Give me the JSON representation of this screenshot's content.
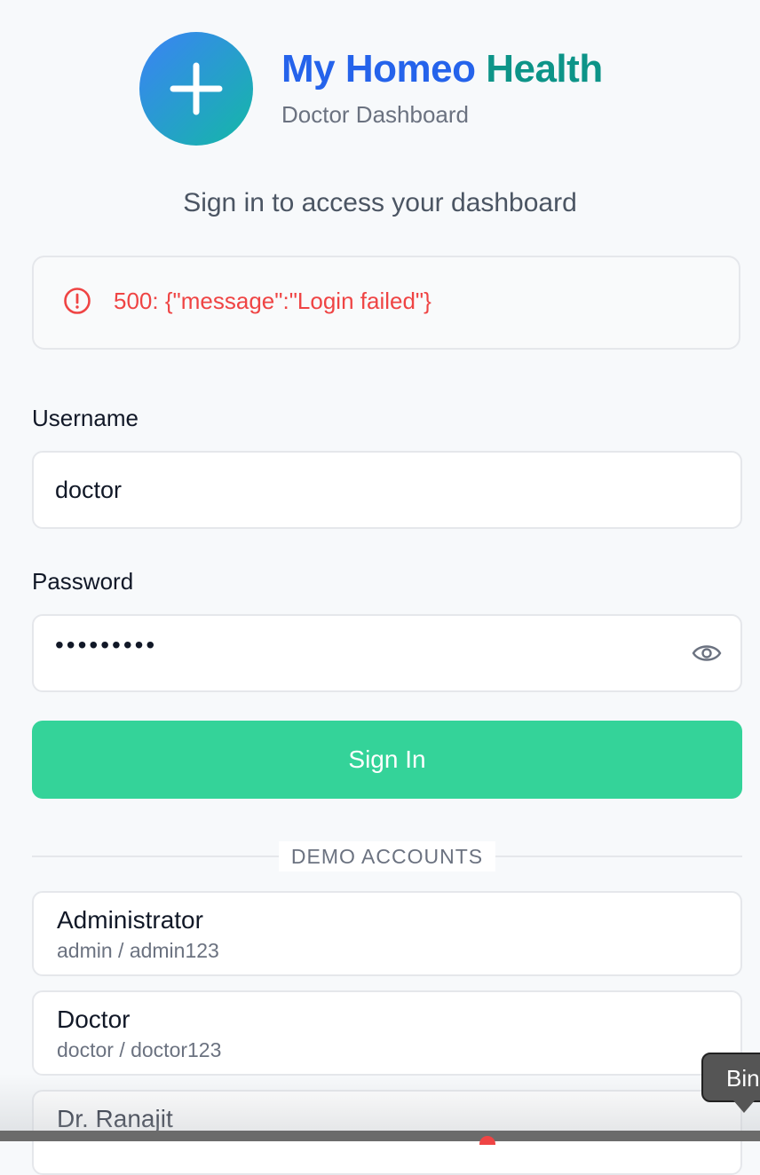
{
  "brand": {
    "title_part1": "My Homeo",
    "title_part2": "Health",
    "subtitle": "Doctor Dashboard"
  },
  "page": {
    "subtitle": "Sign in to access your dashboard"
  },
  "alert": {
    "message": "500: {\"message\":\"Login failed\"}",
    "icon": "alert-circle-icon"
  },
  "form": {
    "username_label": "Username",
    "username_value": "doctor",
    "password_label": "Password",
    "password_masked": "•••••••••",
    "show_password_icon": "eye-icon",
    "submit_label": "Sign In"
  },
  "demo": {
    "heading": "DEMO ACCOUNTS",
    "accounts": [
      {
        "name": "Administrator",
        "credentials": "admin / admin123"
      },
      {
        "name": "Doctor",
        "credentials": "doctor / doctor123"
      },
      {
        "name": "Dr. Ranajit",
        "credentials": ""
      }
    ]
  },
  "tooltip": {
    "text": "Bin"
  },
  "colors": {
    "brand_blue": "#2563eb",
    "brand_teal": "#0d9488",
    "error_red": "#ef4444",
    "button_green": "#34d399"
  }
}
